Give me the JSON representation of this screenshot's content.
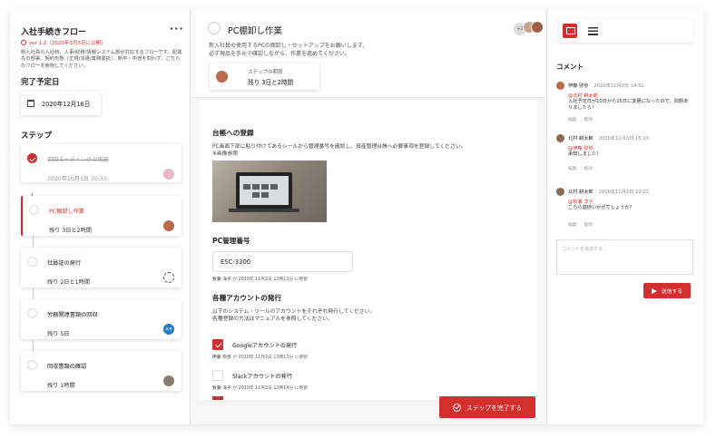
{
  "flow": {
    "title": "入社手続きフロー",
    "version": "ver 1.2（2020年3月3日に公開）",
    "description": "新入社員の入社時、人事/総務/情報システム部が対応するフローです。配属先の部署、契約形態（正規/派遣/業務委託）、新卒・中途を問わず、こちらのフローを使用してください。"
  },
  "due": {
    "heading": "完了予定日",
    "date": "2020年12月16日"
  },
  "steps_heading": "ステップ",
  "steps": [
    {
      "name": "初回ミーティングの実施",
      "meta": "2020年10月1日 10:33",
      "state": "done"
    },
    {
      "name": "PC棚卸し作業",
      "meta": "残り 3日と2時間",
      "state": "active"
    },
    {
      "name": "社員証の発行",
      "meta": "残り 2日と1時間",
      "state": "todo"
    },
    {
      "name": "労務関連書類の回収",
      "meta": "残り 5日",
      "state": "todo",
      "badge": "永井"
    },
    {
      "name": "回収書類の確認",
      "meta": "残り 1時間",
      "state": "todo"
    }
  ],
  "task": {
    "title": "PC棚卸し作業",
    "description_1": "新入社員の使用するPCの棚卸し・セットアップをお願いします。",
    "description_2": "必ず現品を手元で確認しながら、作業を進めてください。",
    "deadline_label": "ステップの期限",
    "deadline_value": "残り 3日と2時間",
    "assignee_extra": "+2"
  },
  "sections": {
    "ledger_head": "台帳への登録",
    "ledger_text_1": "PC画面下部に貼り付けてあるシールから管理番号を確認し、資産管理台帳へ必要事項を登録してください。",
    "ledger_text_2": "※画像参照",
    "pcnum_head": "PC管理番号",
    "pcnum_value": "ESC-3300",
    "pcnum_meta_name": "牧瀬 洋子",
    "pcnum_meta_time": "が 2020年 11月3日 13時13分 に更新",
    "accounts_head": "各種アカウントの発行",
    "accounts_text_1": "以下のシステム・ツールのアカウントをそれぞれ発行してください。",
    "accounts_text_2": "各種登録の方法はマニュアルを参照してください。",
    "checks": [
      {
        "label": "Googleアカウントの発行",
        "checked": true,
        "meta_name": "伊藤 弥歩",
        "meta_time": "が 2020年 11月3日 13時13分 に更新"
      },
      {
        "label": "Slackアカウントの発行",
        "checked": false,
        "meta_name": "牧瀬 洋子",
        "meta_time": "が 2020年 11月3日 13時14分 に更新"
      }
    ]
  },
  "complete_button": "ステップを完了する",
  "comments_heading": "コメント",
  "comments": [
    {
      "name": "伊藤 弥歩",
      "time": "2020年11月3日 14:52",
      "mention": "@北村 耕太郎",
      "body": "入社予定日が10日から15日に変更になったので、問題ありましたら！",
      "edit": "編集",
      "delete": "削除"
    },
    {
      "name": "北村 耕太郎",
      "time": "2020年11月3日 15:10",
      "mention": "@伊藤 弥歩",
      "body": "承知しました！",
      "edit": "編集",
      "delete": "削除"
    },
    {
      "name": "北村 耕太郎",
      "time": "2020年11月3日 10:12",
      "mention": "@牧瀬 洋子",
      "body": "こちら進捗いかがでしょうか？",
      "edit": "編集",
      "delete": "削除"
    }
  ],
  "comment_input": {
    "placeholder": "コメントを追加する..."
  },
  "send_button": "送信する",
  "colors": {
    "accent": "#d32f2f"
  }
}
